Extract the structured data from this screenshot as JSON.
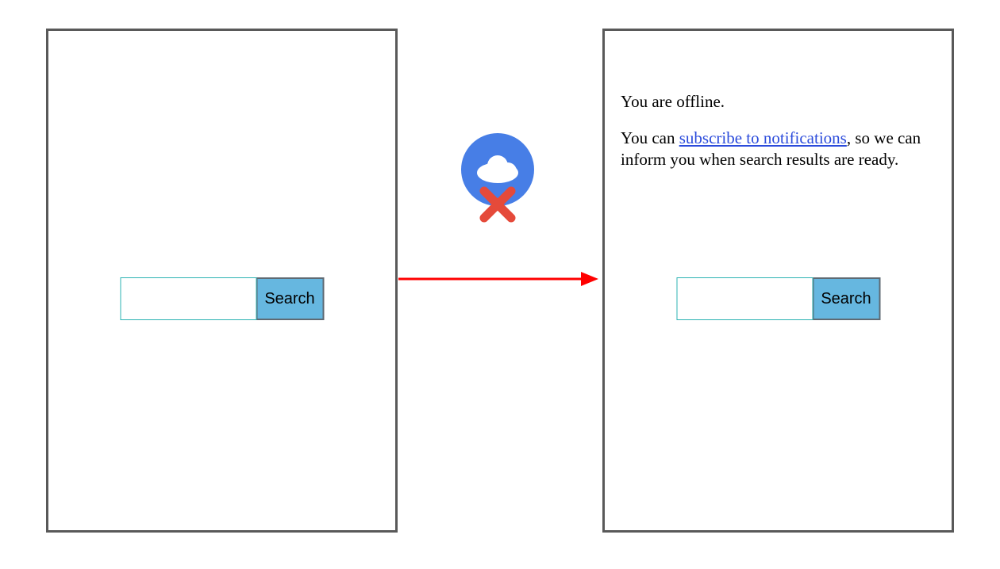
{
  "left": {
    "search": {
      "value": "",
      "button_label": "Search"
    }
  },
  "right": {
    "message": {
      "line1": "You are offline.",
      "line2_pre": "You can ",
      "link_text": "subscribe to notifications",
      "line2_post": ", so we can inform you when search results are ready."
    },
    "search": {
      "value": "",
      "button_label": "Search"
    }
  },
  "icons": {
    "offline": "cloud-offline-icon",
    "arrow": "transition-arrow"
  },
  "colors": {
    "frame_border": "#595959",
    "input_border": "#2bb3b3",
    "button_fill": "#66b7e0",
    "button_border": "#5f6a73",
    "link": "#2b4bdb",
    "cloud_circle": "#477ee6",
    "cloud_white": "#ffffff",
    "cross": "#e54a3a",
    "arrow": "#ff0000"
  }
}
